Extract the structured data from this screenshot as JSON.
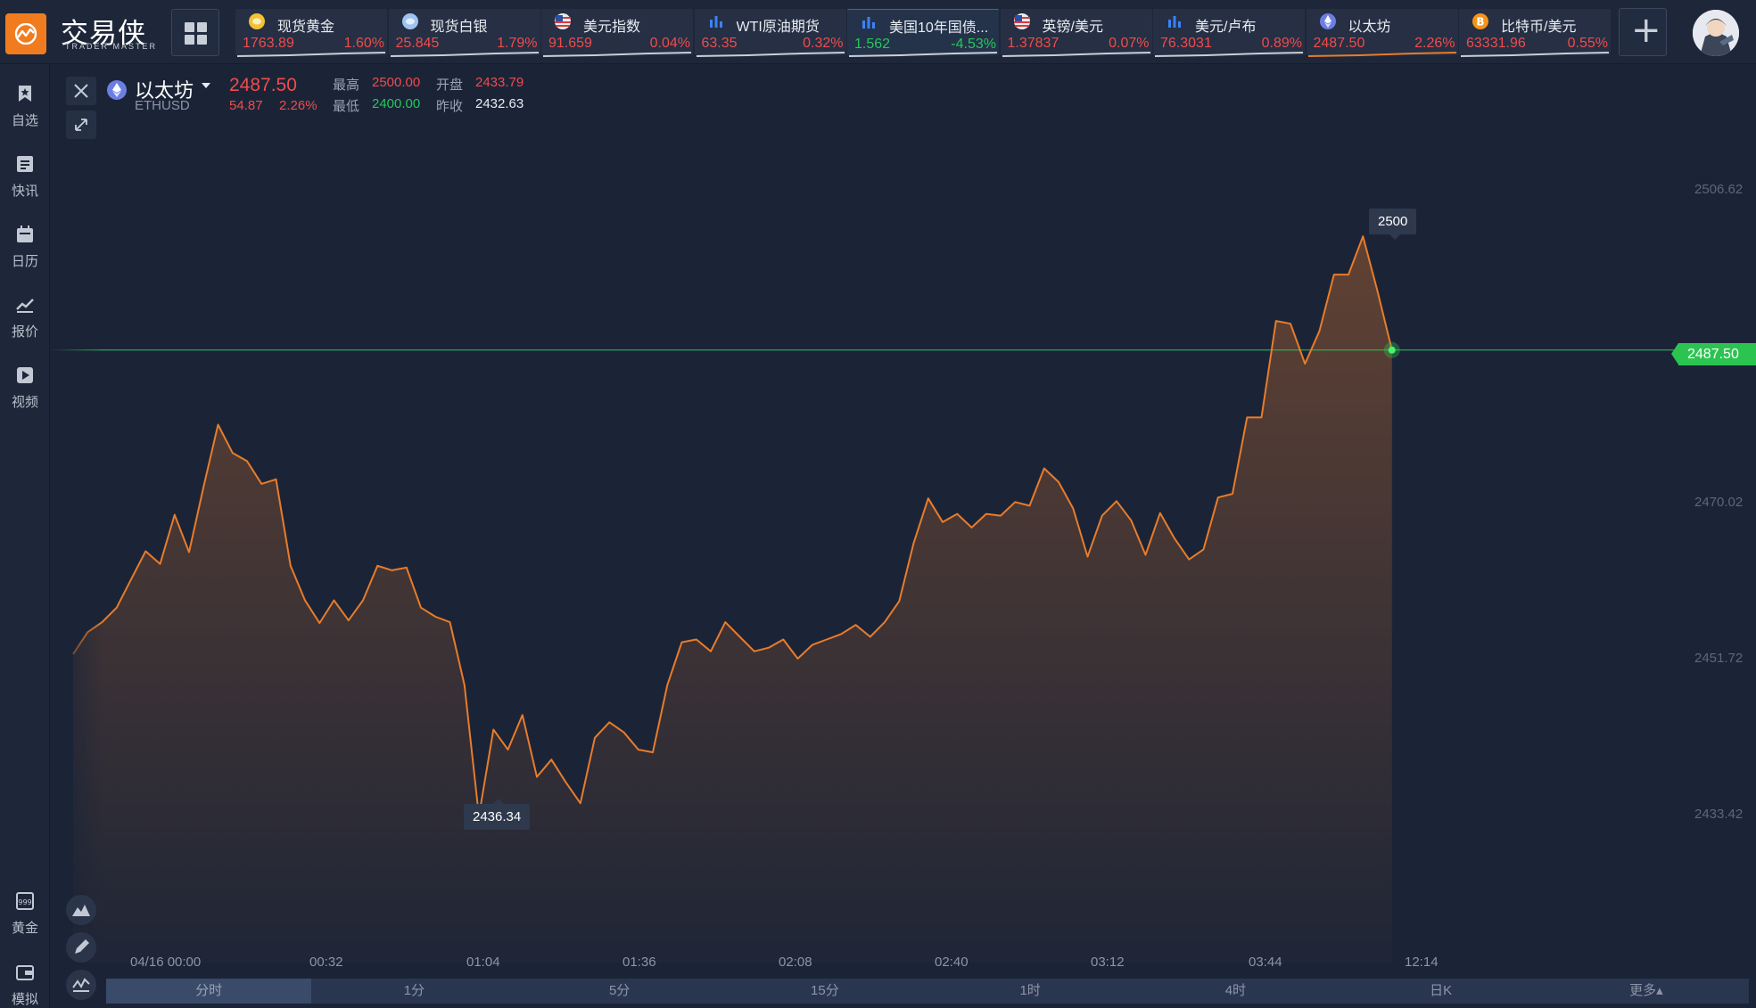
{
  "app": {
    "name": "交易侠",
    "subtitle": "TRADER MASTER"
  },
  "tickers": [
    {
      "name": "现货黄金",
      "price": "1763.89",
      "change": "1.60%",
      "dir": "up",
      "icon": "gold-coin-icon",
      "color": "#f2c233"
    },
    {
      "name": "现货白银",
      "price": "25.845",
      "change": "1.79%",
      "dir": "up",
      "icon": "silver-coin-icon",
      "color": "#9fc3f0"
    },
    {
      "name": "美元指数",
      "price": "91.659",
      "change": "0.04%",
      "dir": "up",
      "icon": "us-flag-icon",
      "color": "#d9dde6"
    },
    {
      "name": "WTI原油期货",
      "price": "63.35",
      "change": "0.32%",
      "dir": "up",
      "icon": "bar-chart-icon",
      "color": "#3b82f6"
    },
    {
      "name": "美国10年国债...",
      "price": "1.562",
      "change": "-4.53%",
      "dir": "down",
      "icon": "bar-chart-icon",
      "color": "#3b82f6"
    },
    {
      "name": "英镑/美元",
      "price": "1.37837",
      "change": "0.07%",
      "dir": "up",
      "icon": "uk-flag-icon",
      "color": "#d9dde6"
    },
    {
      "name": "美元/卢布",
      "price": "76.3031",
      "change": "0.89%",
      "dir": "up",
      "icon": "bar-chart-icon",
      "color": "#3b82f6"
    },
    {
      "name": "以太坊",
      "price": "2487.50",
      "change": "2.26%",
      "dir": "up",
      "icon": "ethereum-icon",
      "color": "#6b7fe3"
    },
    {
      "name": "比特币/美元",
      "price": "63331.96",
      "change": "0.55%",
      "dir": "up",
      "icon": "bitcoin-icon",
      "color": "#f7931a"
    }
  ],
  "sidebar": {
    "items": [
      {
        "label": "自选",
        "icon": "bookmark-icon"
      },
      {
        "label": "快讯",
        "icon": "news-icon"
      },
      {
        "label": "日历",
        "icon": "calendar-icon"
      },
      {
        "label": "报价",
        "icon": "line-chart-icon"
      },
      {
        "label": "视频",
        "icon": "video-icon"
      }
    ],
    "bottom": [
      {
        "label": "黄金",
        "icon": "gold-bar-icon"
      },
      {
        "label": "模拟",
        "icon": "wallet-icon"
      }
    ]
  },
  "symbol": {
    "name": "以太坊",
    "code": "ETHUSD",
    "price": "2487.50",
    "change": "54.87",
    "change_pct": "2.26%",
    "high_label": "最高",
    "high": "2500.00",
    "low_label": "最低",
    "low": "2400.00",
    "open_label": "开盘",
    "open": "2433.79",
    "prev_label": "昨收",
    "prev": "2432.63"
  },
  "chart_data": {
    "type": "area",
    "x": [
      "04/16 00:00",
      "00:32",
      "01:04",
      "01:36",
      "02:08",
      "02:40",
      "03:12",
      "03:44",
      "12:14"
    ],
    "y_ticks": [
      "2506.62",
      "2470.02",
      "2451.72",
      "2433.42"
    ],
    "ylim": [
      2420.2,
      2510.3
    ],
    "current_price": "2487.50",
    "high_label": "2500",
    "low_label": "2436.34",
    "values": [
      2454.1,
      2456.5,
      2457.6,
      2459.2,
      2462.3,
      2465.4,
      2464.0,
      2469.4,
      2465.3,
      2472.5,
      2479.3,
      2476.2,
      2475.3,
      2472.8,
      2473.3,
      2463.8,
      2460.0,
      2457.5,
      2460.0,
      2457.8,
      2460.0,
      2463.8,
      2463.3,
      2463.6,
      2459.2,
      2458.2,
      2457.6,
      2450.7,
      2436.3,
      2445.8,
      2443.6,
      2447.4,
      2440.6,
      2442.5,
      2440.0,
      2437.7,
      2444.9,
      2446.6,
      2445.5,
      2443.6,
      2443.3,
      2450.7,
      2455.4,
      2455.7,
      2454.4,
      2457.6,
      2456.0,
      2454.4,
      2454.8,
      2455.7,
      2453.6,
      2455.1,
      2455.7,
      2456.3,
      2457.3,
      2456.0,
      2457.6,
      2459.9,
      2466.3,
      2471.2,
      2468.6,
      2469.5,
      2468.0,
      2469.5,
      2469.3,
      2470.8,
      2470.4,
      2474.5,
      2473.0,
      2470.1,
      2464.8,
      2469.3,
      2470.9,
      2468.8,
      2465.0,
      2469.6,
      2466.8,
      2464.5,
      2465.6,
      2471.3,
      2471.7,
      2480.1,
      2480.1,
      2490.7,
      2490.4,
      2486.0,
      2489.6,
      2495.8,
      2495.8,
      2500.0,
      2494.0,
      2487.5
    ]
  },
  "periods": [
    "分时",
    "1分",
    "5分",
    "15分",
    "1时",
    "4时",
    "日K",
    "更多▴"
  ],
  "selected_period": "分时",
  "colors": {
    "up": "#f04b4b",
    "down": "#25c65b",
    "line": "#e87c2b",
    "accent": "#f07c1f"
  }
}
